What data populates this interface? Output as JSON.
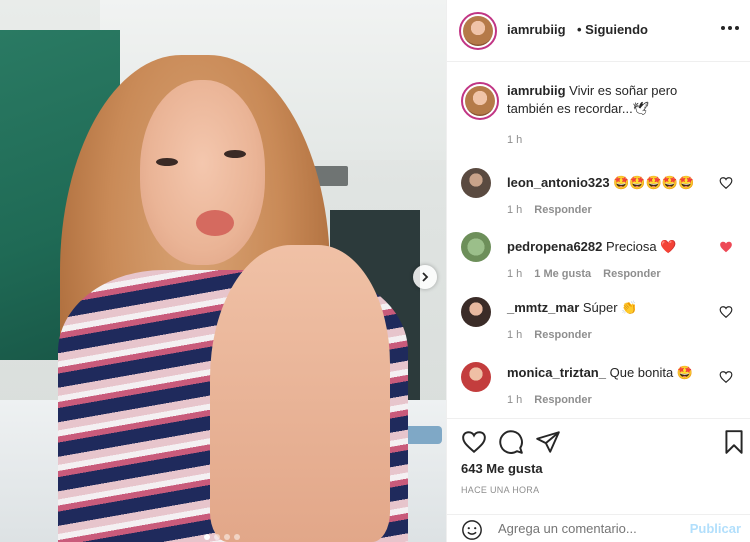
{
  "post": {
    "likes": "643 Me gusta",
    "time_ago": "HACE UNA HORA",
    "photo_count": 4,
    "photo_index": 1
  },
  "header": {
    "username": "iamrubiig",
    "follow_status": "• Siguiendo",
    "more_icon": "more-horizontal-icon"
  },
  "caption": {
    "username": "iamrubiig",
    "text": "Vivir es soñar pero también es recordar...",
    "emoji": "🕊",
    "time": "1 h"
  },
  "comments": [
    {
      "username": "leon_antonio323",
      "text": "🤩🤩🤩🤩🤩",
      "time": "1 h",
      "likes": "",
      "reply": "Responder",
      "liked": false
    },
    {
      "username": "pedropena6282",
      "text": "Preciosa",
      "emoji": "❤️",
      "time": "1 h",
      "likes": "1 Me gusta",
      "reply": "Responder",
      "liked": true
    },
    {
      "username": "_mmtz_mar",
      "text": "Súper 👏",
      "time": "1 h",
      "likes": "",
      "reply": "Responder",
      "liked": false
    },
    {
      "username": "monica_triztan_",
      "text": "Que bonita 🤩",
      "time": "1 h",
      "likes": "",
      "reply": "Responder",
      "liked": false
    }
  ],
  "comment_box": {
    "placeholder": "Agrega un comentario...",
    "publish": "Publicar"
  },
  "colors": {
    "accent_blue": "#b2dffc",
    "liked_red": "#ed4956",
    "text": "#262626",
    "muted": "#8e8e8e"
  }
}
